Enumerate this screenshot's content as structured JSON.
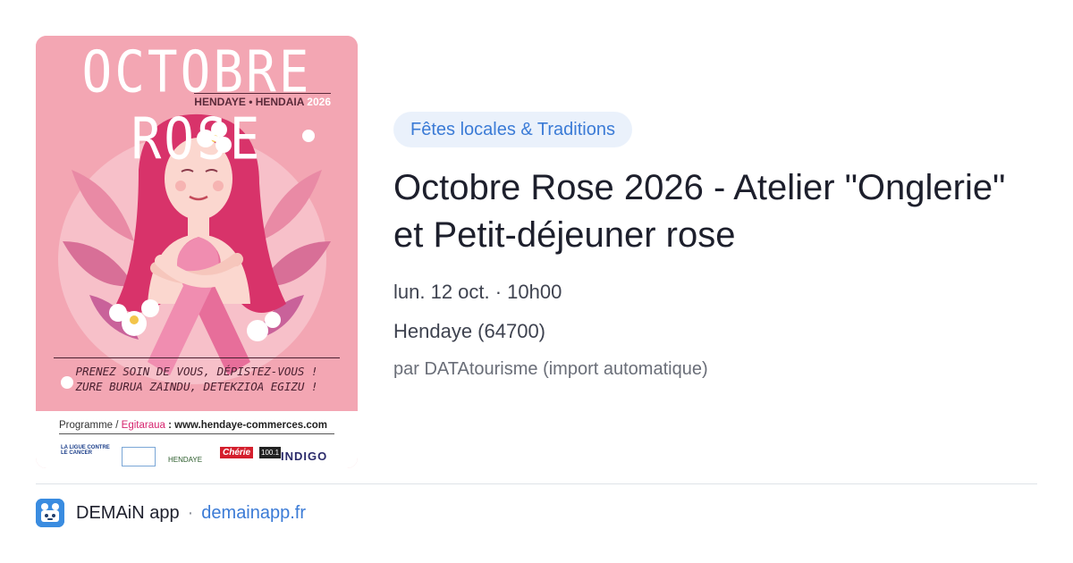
{
  "poster": {
    "title": "OCTOBRE ROSE",
    "subtitle": "HENDAYE • HENDAIA",
    "year": "2026",
    "slogan_fr": "PRENEZ SOIN DE VOUS, DÉPISTEZ-VOUS !",
    "slogan_eu": "ZURE BURUA ZAINDU, DETEKZIOA EGIZU !",
    "program_label": "Programme",
    "program_label_eu": "Egitaraua",
    "program_url": ": www.hendaye-commerces.com",
    "sponsors": {
      "ligue": "LA LIGUE CONTRE LE CANCER",
      "hendaye": "HENDAYE",
      "cherie": "Chérie",
      "cherie_freq": "100.1",
      "indigo": "INDIGO"
    }
  },
  "event": {
    "category": "Fêtes locales & Traditions",
    "title": "Octobre Rose 2026 - Atelier \"Onglerie\" et Petit-déjeuner rose",
    "date": "lun. 12 oct. · 10h00",
    "location": "Hendaye (64700)",
    "source": "par DATAtourisme (import automatique)"
  },
  "footer": {
    "app_name": "DEMAiN app",
    "separator": "·",
    "domain": "demainapp.fr"
  },
  "colors": {
    "accent": "#3b7bd6",
    "category_bg": "#eaf1fb",
    "poster_pink": "#f3a6b3",
    "title_text": "#1d1f2c"
  }
}
